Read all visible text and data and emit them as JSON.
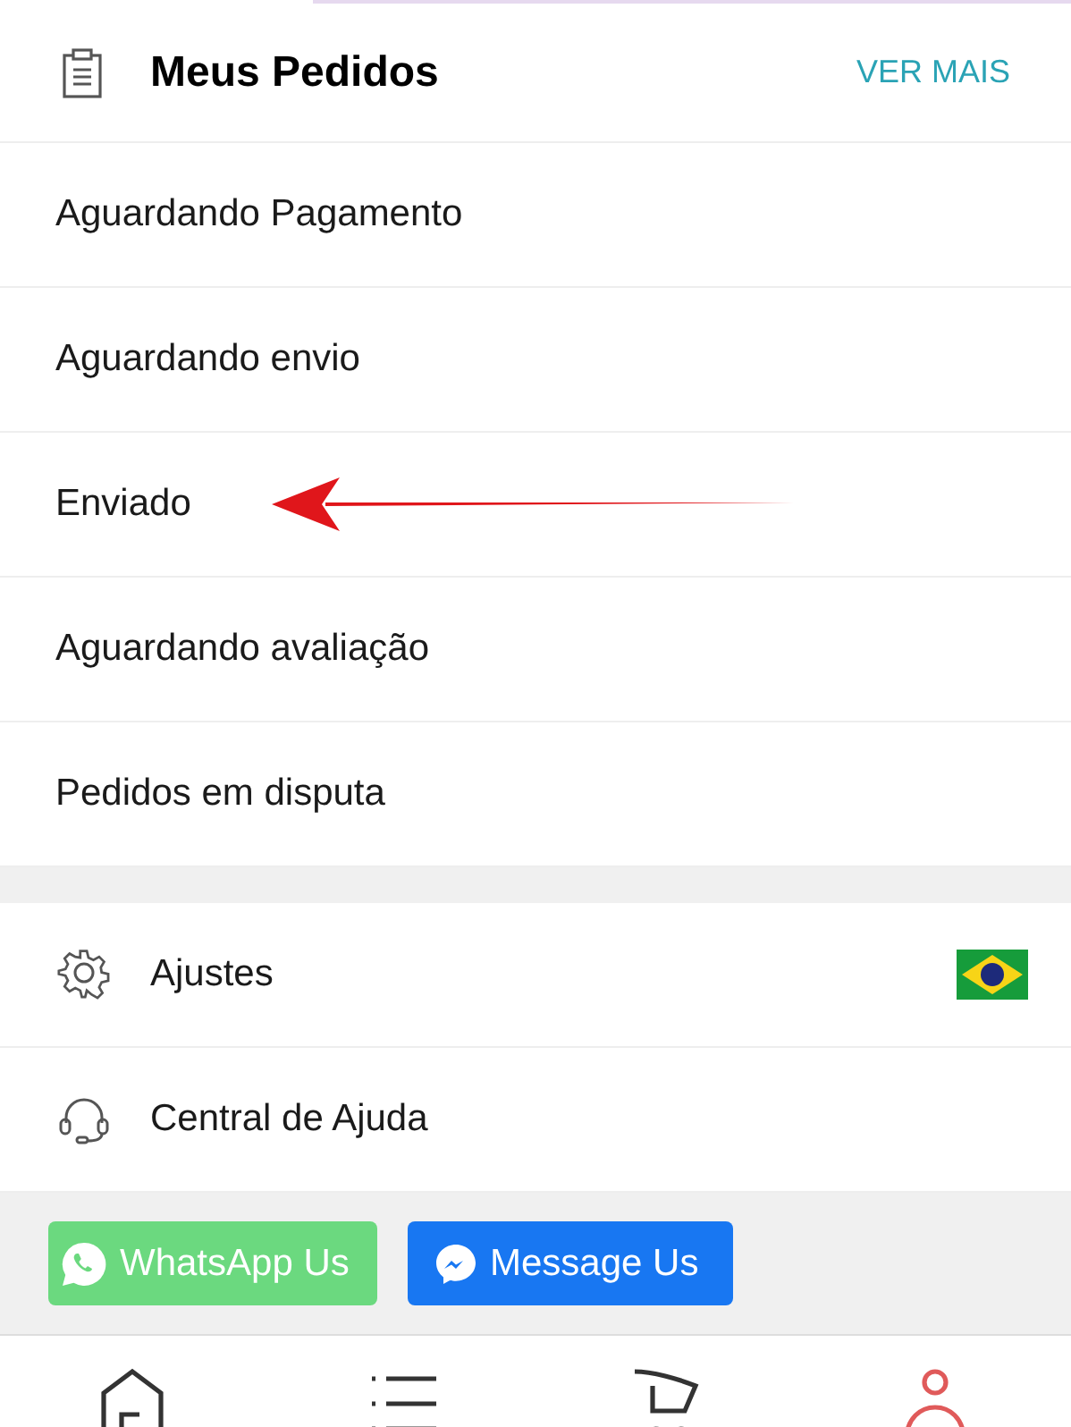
{
  "orders": {
    "title": "Meus Pedidos",
    "link": "VER MAIS",
    "items": [
      {
        "label": "Aguardando Pagamento",
        "highlighted": false
      },
      {
        "label": "Aguardando envio",
        "highlighted": false
      },
      {
        "label": "Enviado",
        "highlighted": true
      },
      {
        "label": "Aguardando avaliação",
        "highlighted": false
      },
      {
        "label": "Pedidos em disputa",
        "highlighted": false
      }
    ]
  },
  "settings": [
    {
      "kind": "settings",
      "label": "Ajustes",
      "flag": true
    },
    {
      "kind": "help",
      "label": "Central de Ajuda",
      "flag": false
    }
  ],
  "contact_buttons": [
    {
      "kind": "whatsapp",
      "label": "WhatsApp Us"
    },
    {
      "kind": "messenger",
      "label": "Message Us"
    }
  ],
  "bottom_nav": [
    {
      "kind": "home",
      "selected": false
    },
    {
      "kind": "list",
      "selected": false
    },
    {
      "kind": "cart",
      "selected": false
    },
    {
      "kind": "profile",
      "selected": true
    }
  ]
}
